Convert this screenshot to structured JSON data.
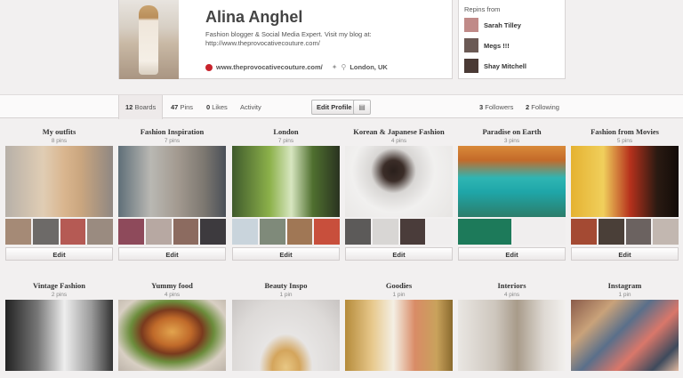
{
  "profile": {
    "name": "Alina Anghel",
    "bio": "Fashion blogger & Social Media Expert. Visit my blog at: http://www.theprovocativecouture.com/",
    "website": "www.theprovocativecouture.com/",
    "location": "London, UK"
  },
  "repins": {
    "title": "Repins from",
    "users": [
      "Sarah Tilley",
      "Megs !!!",
      "Shay Mitchell"
    ]
  },
  "tabs": {
    "boards_count": "12",
    "boards_label": "Boards",
    "pins_count": "47",
    "pins_label": "Pins",
    "likes_count": "0",
    "likes_label": "Likes",
    "activity_label": "Activity",
    "edit_profile": "Edit Profile",
    "followers_count": "3",
    "followers_label": "Followers",
    "following_count": "2",
    "following_label": "Following"
  },
  "edit_label": "Edit",
  "boards": [
    {
      "title": "My outfits",
      "count": "8 pins"
    },
    {
      "title": "Fashion Inspiration",
      "count": "7 pins"
    },
    {
      "title": "London",
      "count": "7 pins"
    },
    {
      "title": "Korean & Japanese Fashion",
      "count": "4 pins"
    },
    {
      "title": "Paradise on Earth",
      "count": "3 pins"
    },
    {
      "title": "Fashion from Movies",
      "count": "5 pins"
    },
    {
      "title": "Vintage Fashion",
      "count": "2 pins"
    },
    {
      "title": "Yummy food",
      "count": "4 pins"
    },
    {
      "title": "Beauty Inspo",
      "count": "1 pin"
    },
    {
      "title": "Goodies",
      "count": "1 pin"
    },
    {
      "title": "Interiors",
      "count": "4 pins"
    },
    {
      "title": "Instagram",
      "count": "1 pin"
    }
  ]
}
